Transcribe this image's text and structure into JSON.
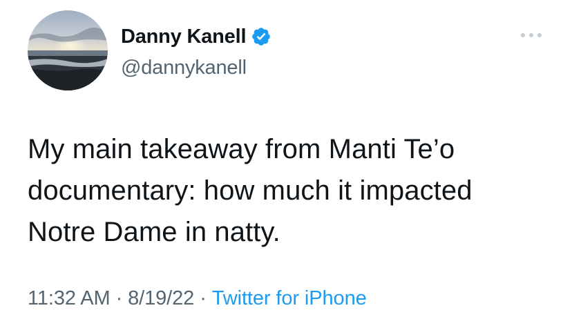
{
  "user": {
    "display_name": "Danny Kanell",
    "handle": "@dannykanell",
    "verified": true,
    "avatar": "beach-sunset-photo"
  },
  "tweet": {
    "lines": [
      "My main takeaway from Manti Te’o",
      "documentary: how much it impacted",
      "Notre Dame in natty."
    ],
    "time": "11:32 AM",
    "date": "8/19/22",
    "separator": "·",
    "source": "Twitter for iPhone"
  },
  "icons": {
    "verified": "verified-badge-icon",
    "more": "more-options-icon"
  },
  "colors": {
    "text": "#0f1419",
    "secondary": "#536471",
    "link": "#1d9bf0",
    "verified": "#1d9bf0"
  }
}
